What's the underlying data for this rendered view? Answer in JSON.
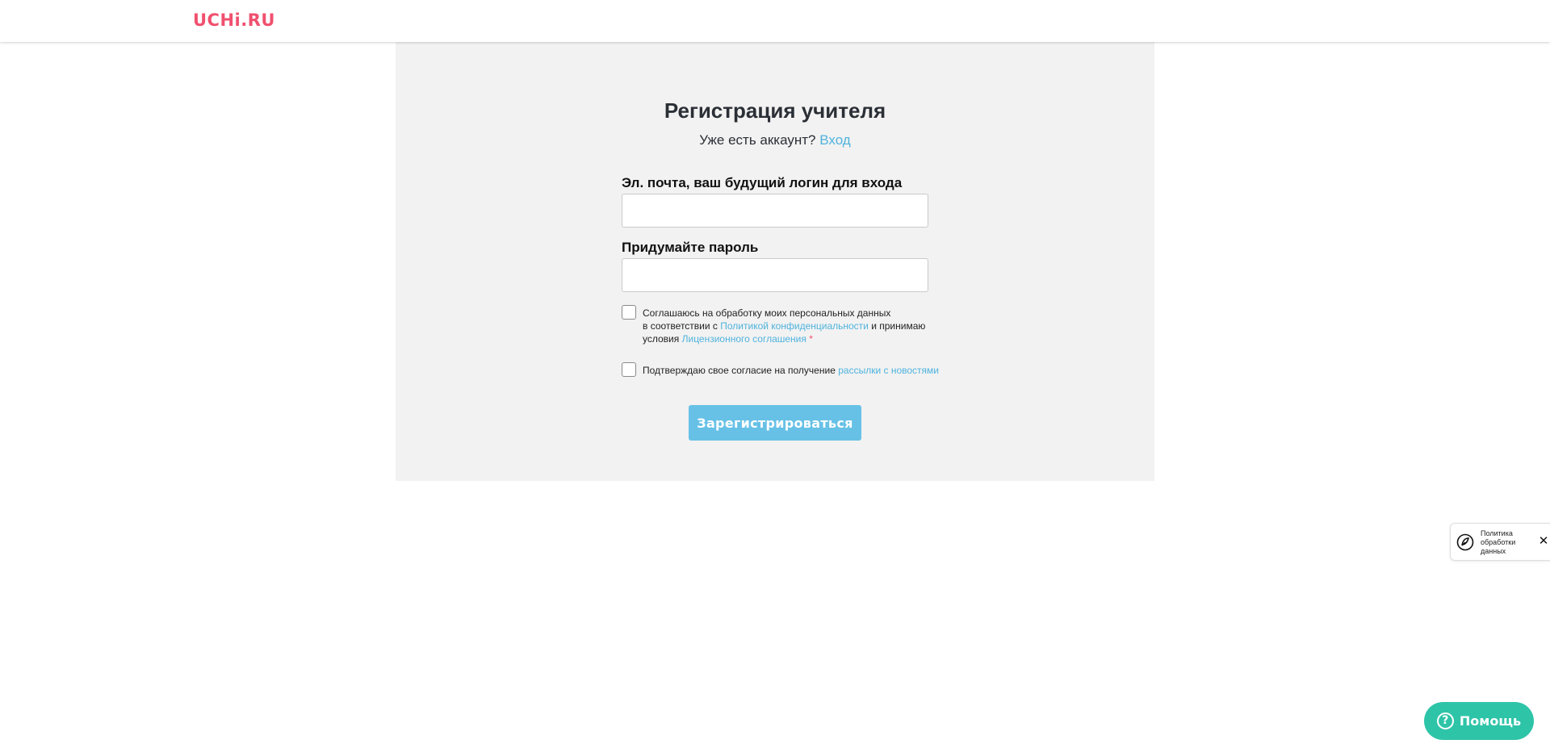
{
  "header": {
    "logo_text": "UCHi.RU"
  },
  "form": {
    "title": "Регистрация учителя",
    "subtitle_text": "Уже есть аккаунт?",
    "login_link": "Вход",
    "email_label": "Эл. почта, ваш будущий логин для входа",
    "email_value": "",
    "password_label": "Придумайте пароль",
    "password_value": "",
    "consent": {
      "line1": "Соглашаюсь на обработку моих персональных данных",
      "line2_prefix": "в соответствии с",
      "privacy_link": "Политикой конфиденциальности",
      "line2_suffix": "и принимаю",
      "line3_prefix": "условия",
      "license_link": "Лицензионного соглашения",
      "required_mark": "*"
    },
    "newsletter": {
      "text": "Подтверждаю свое согласие на получение",
      "link": "рассылки с новостями"
    },
    "submit_label": "Зарегистрироваться"
  },
  "privacy_popup": {
    "text": "Политика обработки данных",
    "icon": "privacy-shield-icon",
    "close": "✕"
  },
  "help": {
    "label": "Помощь",
    "icon_glyph": "?"
  },
  "colors": {
    "brand": "#f0506e",
    "link": "#4fb3dd",
    "button": "#67c1e6",
    "help": "#2ec4a8",
    "panel": "#f2f2f2"
  }
}
